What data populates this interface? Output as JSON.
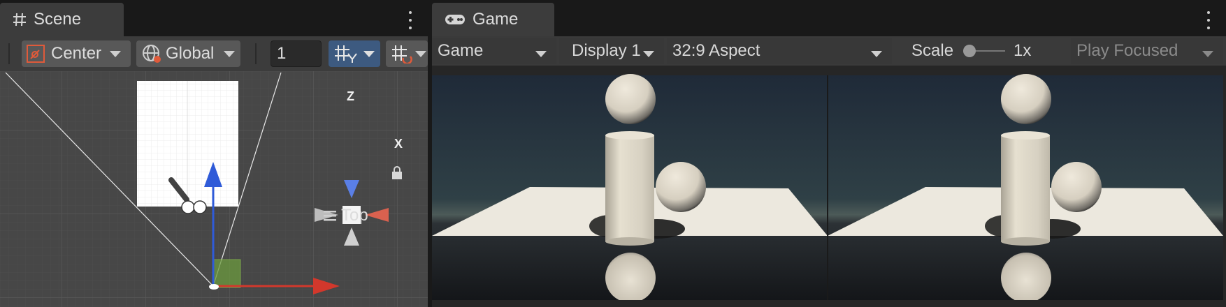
{
  "scene": {
    "tab_label": "Scene",
    "toolbar": {
      "pivot_label": "Center",
      "space_label": "Global",
      "snap_value": "1"
    },
    "gizmo": {
      "axis_z": "Z",
      "axis_x": "X",
      "view_label": "Top"
    }
  },
  "game": {
    "tab_label": "Game",
    "toolbar": {
      "mode_label": "Game",
      "display_label": "Display 1",
      "aspect_label": "32:9 Aspect",
      "scale_label": "Scale",
      "scale_value": "1x",
      "scale_slider_fraction": 0.0,
      "play_mode_label": "Play Focused"
    }
  },
  "colors": {
    "panel": "#3c3c3c",
    "tabstrip": "#191919",
    "button": "#585858",
    "accent_blue": "#3d5a80",
    "axis_x": "#d2382c",
    "axis_y": "#2f5bd8",
    "axis_z_gizmo": "#5a7fe6"
  }
}
